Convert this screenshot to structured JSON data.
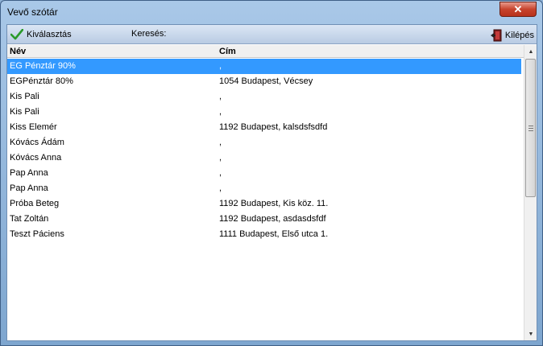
{
  "window": {
    "title": "Vevő szótár",
    "close_glyph": "✕"
  },
  "toolbar": {
    "select_label": "Kiválasztás",
    "search_label": "Keresés:",
    "search_value": "",
    "exit_label": "Kilépés",
    "select_icon": "check-icon",
    "exit_icon": "exit-door-icon",
    "accent_color": "#2a9a2a"
  },
  "grid": {
    "columns": [
      "Név",
      "Cím"
    ],
    "rows": [
      {
        "name": "EG Pénztár 90%",
        "address": ",",
        "selected": true
      },
      {
        "name": "EGPénztár 80%",
        "address": "1054 Budapest, Vécsey"
      },
      {
        "name": "Kis Pali",
        "address": ","
      },
      {
        "name": "Kis Pali",
        "address": ","
      },
      {
        "name": "Kiss Elemér",
        "address": "1192 Budapest, kalsdsfsdfd"
      },
      {
        "name": "Kóvács Ádám",
        "address": ","
      },
      {
        "name": "Kóvács Anna",
        "address": ","
      },
      {
        "name": "Pap Anna",
        "address": ","
      },
      {
        "name": "Pap Anna",
        "address": ","
      },
      {
        "name": "Próba Beteg",
        "address": "1192 Budapest, Kis köz. 11."
      },
      {
        "name": "Tat Zoltán",
        "address": "1192 Budapest, asdasdsfdf"
      },
      {
        "name": "Teszt Páciens",
        "address": "1111 Budapest, Első utca 1."
      }
    ],
    "selected_color": "#3399ff"
  },
  "scrollbar": {
    "up_glyph": "▲",
    "down_glyph": "▼"
  }
}
